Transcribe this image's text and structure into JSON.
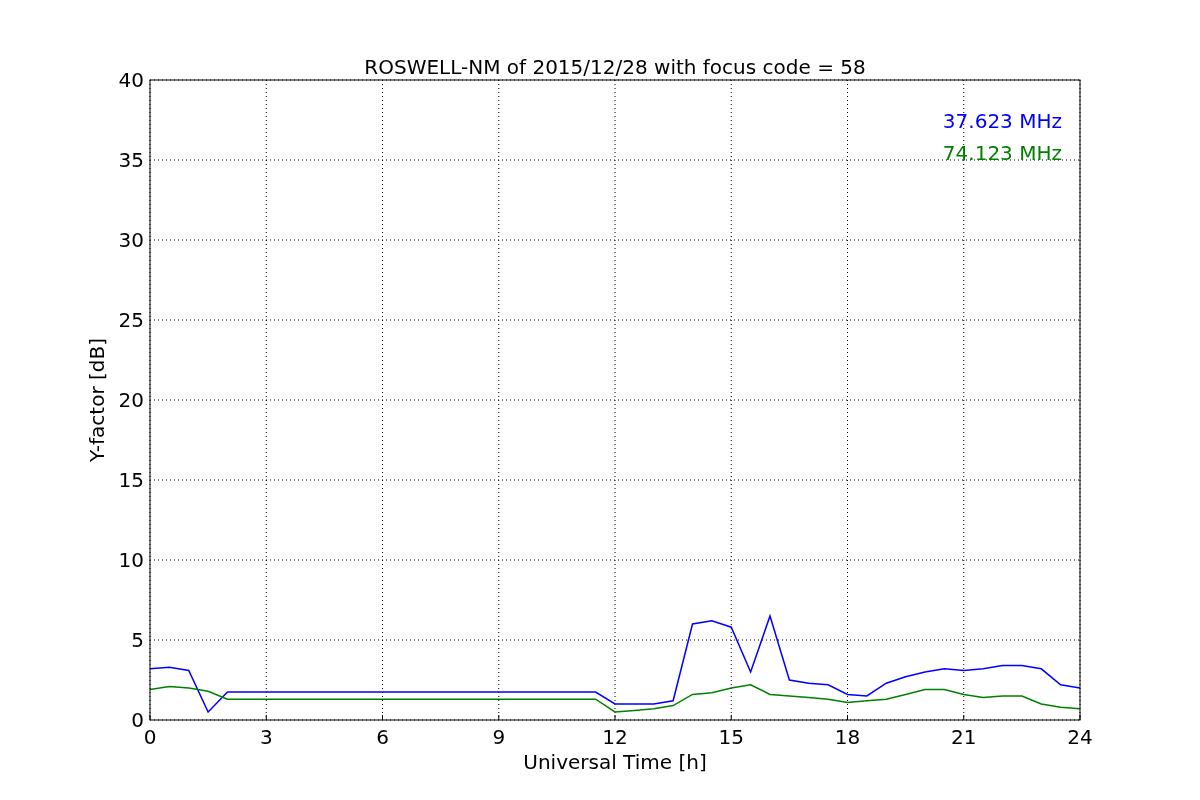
{
  "chart_data": {
    "type": "line",
    "title": "ROSWELL-NM of 2015/12/28 with focus code = 58",
    "xlabel": "Universal Time [h]",
    "ylabel": "Y-factor [dB]",
    "x": [
      0,
      0.5,
      1,
      1.5,
      2,
      2.5,
      3,
      3.5,
      4,
      4.5,
      5,
      5.5,
      6,
      6.5,
      7,
      7.5,
      8,
      8.5,
      9,
      9.5,
      10,
      10.5,
      11,
      11.5,
      12,
      12.5,
      13,
      13.5,
      14,
      14.5,
      15,
      15.5,
      16,
      16.5,
      17,
      17.5,
      18,
      18.5,
      19,
      19.5,
      20,
      20.5,
      21,
      21.5,
      22,
      22.5,
      23,
      23.5,
      24
    ],
    "series": [
      {
        "name": "37.623 MHz",
        "color": "#0000ff",
        "values": [
          3.2,
          3.3,
          3.1,
          0.5,
          1.75,
          1.75,
          1.75,
          1.75,
          1.75,
          1.75,
          1.75,
          1.75,
          1.75,
          1.75,
          1.75,
          1.75,
          1.75,
          1.75,
          1.75,
          1.75,
          1.75,
          1.75,
          1.75,
          1.75,
          1.0,
          1.0,
          1.0,
          1.2,
          6.0,
          6.2,
          5.8,
          3.0,
          6.5,
          2.5,
          2.3,
          2.2,
          1.6,
          1.5,
          2.3,
          2.7,
          3.0,
          3.2,
          3.1,
          3.2,
          3.4,
          3.4,
          3.2,
          2.2,
          2.0
        ]
      },
      {
        "name": "74.123 MHz",
        "color": "#008000",
        "values": [
          1.9,
          2.1,
          2.0,
          1.8,
          1.3,
          1.3,
          1.3,
          1.3,
          1.3,
          1.3,
          1.3,
          1.3,
          1.3,
          1.3,
          1.3,
          1.3,
          1.3,
          1.3,
          1.3,
          1.3,
          1.3,
          1.3,
          1.3,
          1.3,
          0.5,
          0.6,
          0.7,
          0.9,
          1.6,
          1.7,
          2.0,
          2.2,
          1.6,
          1.5,
          1.4,
          1.3,
          1.1,
          1.2,
          1.3,
          1.6,
          1.9,
          1.9,
          1.6,
          1.4,
          1.5,
          1.5,
          1.0,
          0.8,
          0.7
        ]
      }
    ],
    "xlim": [
      0,
      24
    ],
    "ylim": [
      0,
      40
    ],
    "xticks": [
      0,
      3,
      6,
      9,
      12,
      15,
      18,
      21,
      24
    ],
    "yticks": [
      0,
      5,
      10,
      15,
      20,
      25,
      30,
      35,
      40
    ],
    "grid": true
  }
}
